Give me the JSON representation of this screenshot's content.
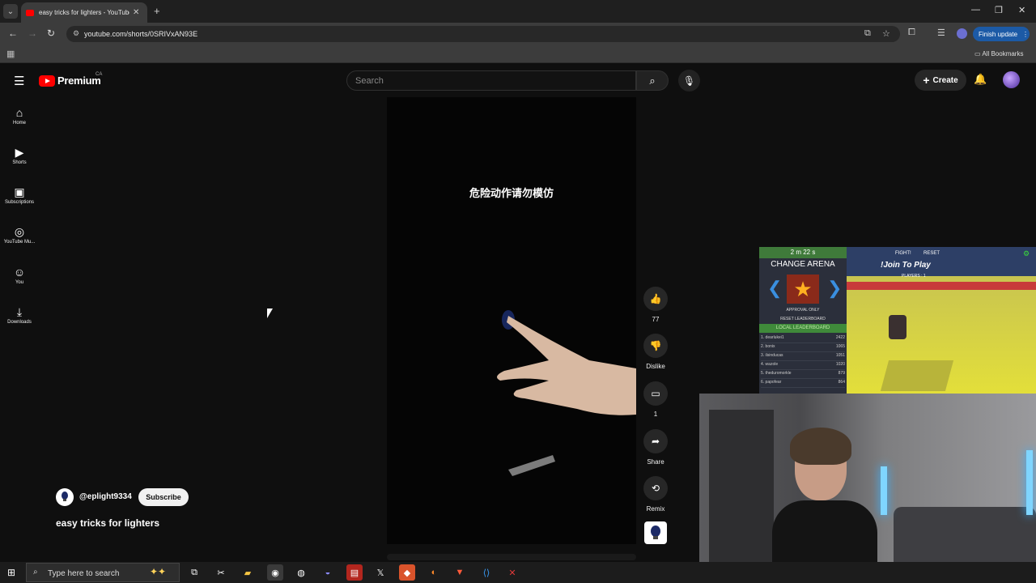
{
  "browser": {
    "tab_title": "easy tricks for lighters - YouTube",
    "url": "youtube.com/shorts/0SRIVxAN93E",
    "finish_update_label": "Finish update",
    "all_bookmarks_label": "All Bookmarks"
  },
  "youtube": {
    "logo_text": "Premium",
    "region": "CA",
    "search_placeholder": "Search",
    "create_label": "Create",
    "sidebar": [
      {
        "label": "Home",
        "icon": "home-icon"
      },
      {
        "label": "Shorts",
        "icon": "shorts-icon"
      },
      {
        "label": "Subscriptions",
        "icon": "subscriptions-icon"
      },
      {
        "label": "YouTube Mu...",
        "icon": "music-icon"
      },
      {
        "label": "You",
        "icon": "you-icon"
      },
      {
        "label": "Downloads",
        "icon": "download-icon"
      }
    ],
    "video_caption": "危险动作请勿模仿",
    "actions": {
      "like_count": "77",
      "dislike_label": "Dislike",
      "comment_count": "1",
      "share_label": "Share",
      "remix_label": "Remix"
    },
    "channel_name": "@eplight9334",
    "subscribe_label": "Subscribe",
    "video_title": "easy tricks for lighters"
  },
  "game": {
    "timer": "2 m 22 s",
    "change_arena": "CHANGE ARENA",
    "approval_only": "APPROVAL ONLY",
    "reset_leaderboard": "RESET LEADERBOARD",
    "local_leaderboard": "LOCAL LEADERBOARD",
    "leaderboard": [
      {
        "name": "1. dearlukei1",
        "score": "2422"
      },
      {
        "name": "2. bonix",
        "score": "1065"
      },
      {
        "name": "3. ilsinducas",
        "score": "1051"
      },
      {
        "name": "4. wazole",
        "score": "1020"
      },
      {
        "name": "5. theduromorkle",
        "score": "879"
      },
      {
        "name": "6. papofear",
        "score": "864"
      }
    ],
    "fight_label": "FIGHT!",
    "reset_label": "RESET",
    "join_label": "!Join To Play",
    "players_label": "PLAYERS : 1"
  },
  "taskbar": {
    "search_placeholder": "Type here to search"
  }
}
